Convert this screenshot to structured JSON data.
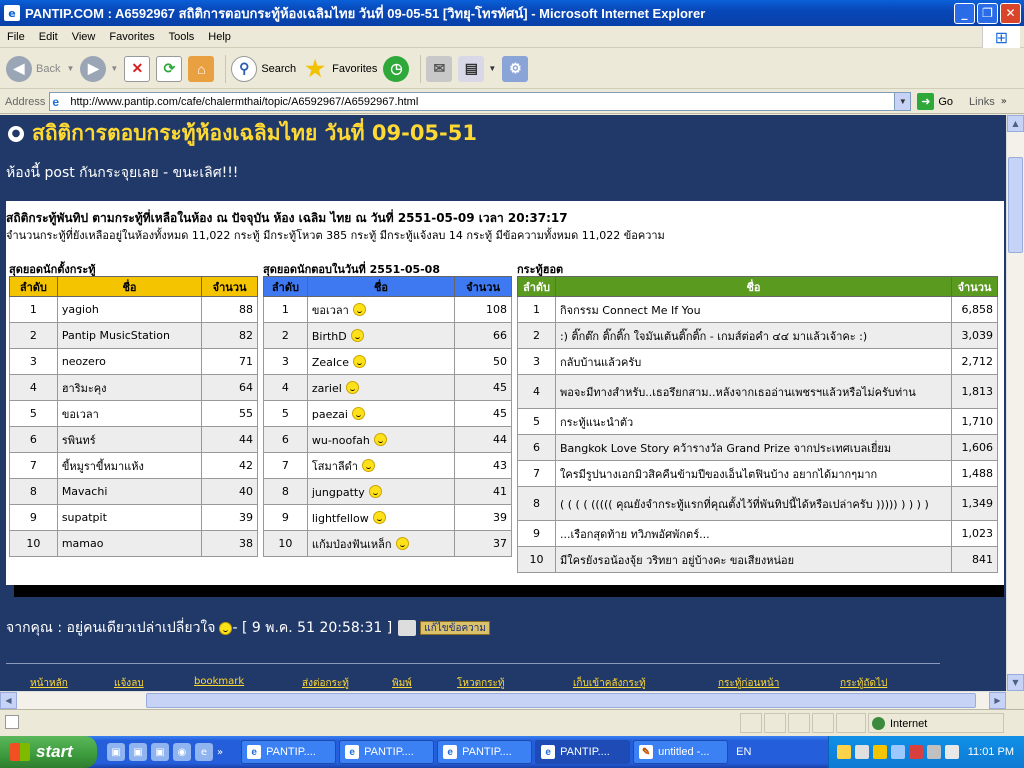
{
  "window": {
    "title": "PANTIP.COM : A6592967 สถิติการตอบกระทู้ห้องเฉลิมไทย วันที่ 09-05-51 [วิทยุ-โทรทัศน์] - Microsoft Internet Explorer",
    "minimize": "_",
    "maximize": "❐",
    "close": "✕"
  },
  "menu": [
    "File",
    "Edit",
    "View",
    "Favorites",
    "Tools",
    "Help"
  ],
  "toolbar": {
    "back": "Back",
    "search": "Search",
    "favorites": "Favorites"
  },
  "address": {
    "label": "Address",
    "url": "http://www.pantip.com/cafe/chalermthai/topic/A6592967/A6592967.html",
    "go": "Go",
    "links": "Links"
  },
  "page": {
    "title": "สถิติการตอบกระทู้ห้องเฉลิมไทย วันที่ 09-05-51",
    "subtitle": "ห้องนี้ post กันกระจุยเลย - ขนะเลิศ!!!",
    "stats_line1": "สถิติกระทู้พันทิป ตามกระทู้ที่เหลือในห้อง ณ ปัจจุบัน ห้อง เฉลิม ไทย ณ วันที่ 2551-05-09 เวลา 20:37:17",
    "stats_line2": "จำนวนกระทู้ที่ยังเหลืออยู่ในห้องทั้งหมด 11,022 กระทู้ มีกระทู้โหวต 385 กระทู้ มีกระทู้แจ้งลบ 14 กระทู้ มีข้อความทั้งหมด 11,022 ข้อความ"
  },
  "table1": {
    "title": "สุดยอดนักตั้งกระทู้",
    "headers": [
      "ลำดับ",
      "ชื่อ",
      "จำนวน"
    ],
    "header_color": "#F5C400",
    "rows": [
      [
        "1",
        "yagioh",
        "88"
      ],
      [
        "2",
        "Pantip MusicStation",
        "82"
      ],
      [
        "3",
        "neozero",
        "71"
      ],
      [
        "4",
        "ฮาริมะคุง",
        "64"
      ],
      [
        "5",
        "ขอเวลา",
        "55"
      ],
      [
        "6",
        "รพินทร์",
        "44"
      ],
      [
        "7",
        "ขี้หมูราขี้หมาแห้ง",
        "42"
      ],
      [
        "8",
        "Mavachi",
        "40"
      ],
      [
        "9",
        "supatpit",
        "39"
      ],
      [
        "10",
        "mamao",
        "38"
      ]
    ]
  },
  "table2": {
    "title": "สุดยอดนักตอบในวันที่ 2551-05-08",
    "headers": [
      "ลำดับ",
      "ชื่อ",
      "จำนวน"
    ],
    "header_color": "#3E79F2",
    "rows": [
      [
        "1",
        "ขอเวลา",
        "108"
      ],
      [
        "2",
        "BirthD",
        "66"
      ],
      [
        "3",
        "ZeaIce",
        "50"
      ],
      [
        "4",
        "zariel",
        "45"
      ],
      [
        "5",
        "paezai",
        "45"
      ],
      [
        "6",
        "wu-noofah",
        "44"
      ],
      [
        "7",
        "โสมาลีดำ",
        "43"
      ],
      [
        "8",
        "jungpatty",
        "41"
      ],
      [
        "9",
        "lightfellow",
        "39"
      ],
      [
        "10",
        "แก้มป่องฟันเหล็ก",
        "37"
      ]
    ]
  },
  "table3": {
    "title": "กระทู้ฮอต",
    "headers": [
      "ลำดับ",
      "ชื่อ",
      "จำนวน"
    ],
    "header_color": "#5A9A1E",
    "rows": [
      [
        "1",
        "กิจกรรม Connect Me If You",
        "6,858"
      ],
      [
        "2",
        ":) ติ๊กต๊ก ติ๊กติ๊ก ใจมันเต้นติ๊กติ๊ก - เกมส์ต่อคำ ๔๔ มาแล้วเจ้าคะ :)",
        "3,039"
      ],
      [
        "3",
        "กลับบ้านแล้วครับ",
        "2,712"
      ],
      [
        "4",
        "พอจะมีทางสำหรับ..เธอรึยกสาม..หลังจากเธออ่านเพชรฯแล้วหรือไม่ครับท่าน",
        "1,813"
      ],
      [
        "5",
        "กระทู้แนะนำตัว",
        "1,710"
      ],
      [
        "6",
        "Bangkok Love Story คว้ารางวัล Grand Prize จากประเทศเบลเยี่ยม",
        "1,606"
      ],
      [
        "7",
        "ใครมีรูปนางเอกมิวสิคคืนข้ามปีของเอ็นไตฟินบ้าง อยากได้มากๆมาก",
        "1,488"
      ],
      [
        "8",
        "( ( ( ( ((((( คุณยังจำกระทู้แรกที่คุณตั้งไว้ที่พันทิปนี้ได้หรือเปล่าครับ ))))) ) ) ) )",
        "1,349"
      ],
      [
        "9",
        "...เรือกสุดท้าย ทวิภพอัศพักตร์...",
        "1,023"
      ],
      [
        "10",
        "มีใครยังรอน้องจุ้ย วริทยา อยู่บ้างคะ ขอเสียงหน่อย",
        "841"
      ]
    ]
  },
  "footer": {
    "from_prefix": "จากคุณ : อยู่คนเดียวเปล่าเปลี่ยวใจ",
    "from_suffix": " - [ 9 พ.ค. 51 20:58:31 ]",
    "edit": "แก้ไขข้อความ",
    "nav": [
      "หน้าหลัก",
      "แจ้งลบ",
      "bookmark",
      "ส่งต่อกระทู้",
      "พิมพ์",
      "โหวตกระทู้",
      "เก็บเข้าคลังกระทู้",
      "กระทู้ก่อนหน้า",
      "กระทู้ถัดไป"
    ]
  },
  "status": {
    "zone": "Internet"
  },
  "taskbar": {
    "start": "start",
    "tasks": [
      "PANTIP....",
      "PANTIP....",
      "PANTIP....",
      "PANTIP....",
      "untitled -..."
    ],
    "lang": "EN",
    "clock": "11:01 PM"
  },
  "colors": {
    "page_bg": "#213969",
    "title_yellow": "#FFD933"
  }
}
